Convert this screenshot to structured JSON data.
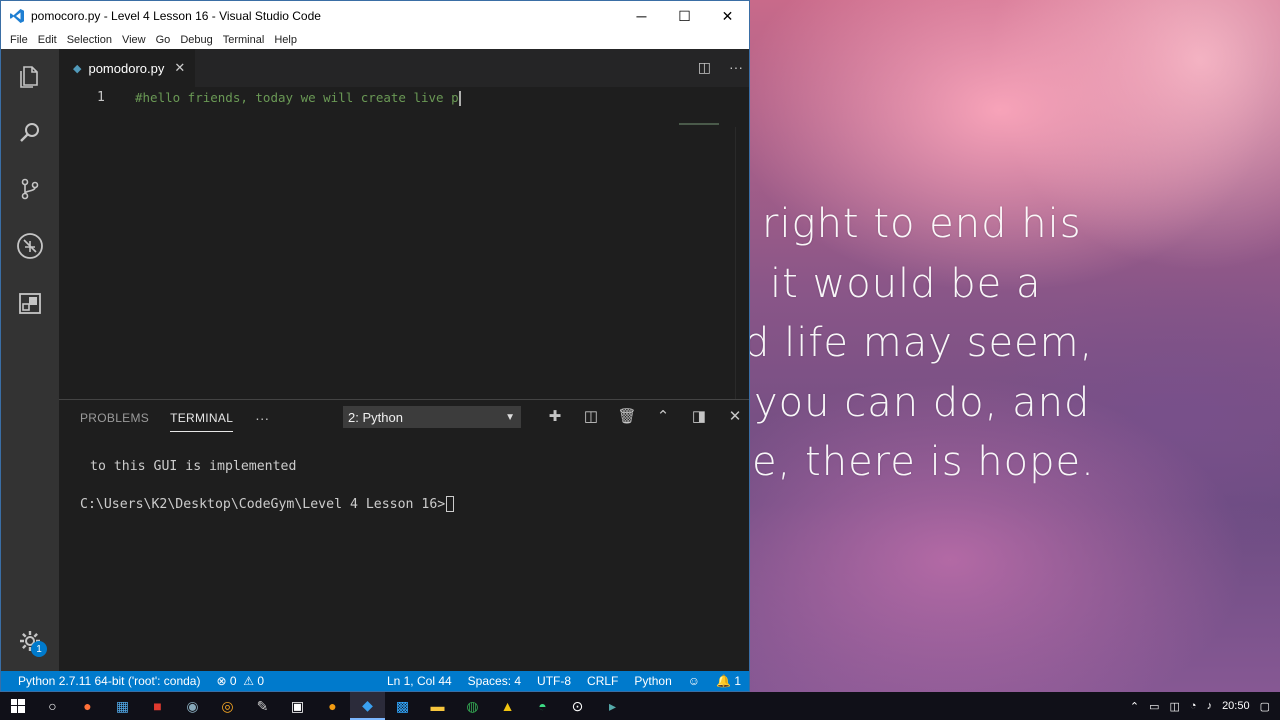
{
  "window": {
    "title": "pomocoro.py - Level 4 Lesson 16 - Visual Studio Code",
    "minimize": "─",
    "maximize": "☐",
    "close": "✕"
  },
  "menu": [
    "File",
    "Edit",
    "Selection",
    "View",
    "Go",
    "Debug",
    "Terminal",
    "Help"
  ],
  "tab": {
    "filename": "pomodoro.py",
    "close": "✕"
  },
  "editor": {
    "line_number": "1",
    "code": "#hello friends, today we will create live p"
  },
  "activity_badge": "1",
  "panel": {
    "tabs": [
      "PROBLEMS",
      "TERMINAL"
    ],
    "more": "···",
    "terminal_select": "2: Python",
    "terminal_lines": [
      "to this GUI is implemented",
      "C:\\Users\\K2\\Desktop\\CodeGym\\Level 4 Lesson 16>"
    ]
  },
  "statusbar": {
    "interpreter": "Python 2.7.11 64-bit ('root': conda)",
    "errors": "0",
    "warnings": "0",
    "position": "Ln 1, Col 44",
    "spaces": "Spaces: 4",
    "encoding": "UTF-8",
    "eol": "CRLF",
    "language": "Python",
    "notifications": "1"
  },
  "wallpaper_quote": [
    "right to end his",
    "it would be a",
    "d life may seem,",
    "you can do, and",
    "e, there is hope."
  ],
  "taskbar": {
    "time": "20:50"
  },
  "colors": {
    "statusbar": "#007acc",
    "activity_bar": "#333333",
    "editor_bg": "#1e1e1e",
    "comment": "#6a9955"
  }
}
